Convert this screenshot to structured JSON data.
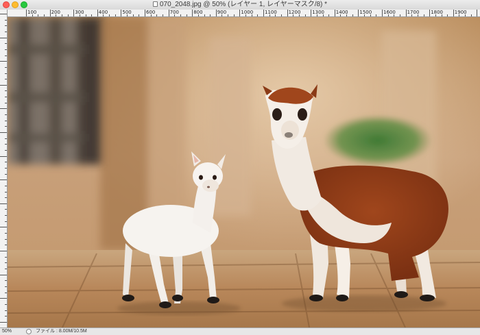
{
  "window": {
    "title": "070_2048.jpg @ 50% (レイヤー 1, レイヤーマスク/8) *"
  },
  "ruler": {
    "horizontal_labels": [
      "100",
      "200",
      "300",
      "400",
      "500",
      "600",
      "700",
      "800",
      "900",
      "1000",
      "1100",
      "1200",
      "1300",
      "1400",
      "1500",
      "1600",
      "1700",
      "1800",
      "1900"
    ]
  },
  "status": {
    "zoom": "50%",
    "file_info": "ファイル : 8.00M/10.5M"
  },
  "icons": {
    "close": "close-button-dot",
    "minimize": "minimize-button-dot",
    "maximize": "zoom-button-dot",
    "document": "document-icon"
  },
  "colors": {
    "close": "#fe5f57",
    "minimize": "#febc2e",
    "maximize": "#28c840"
  }
}
